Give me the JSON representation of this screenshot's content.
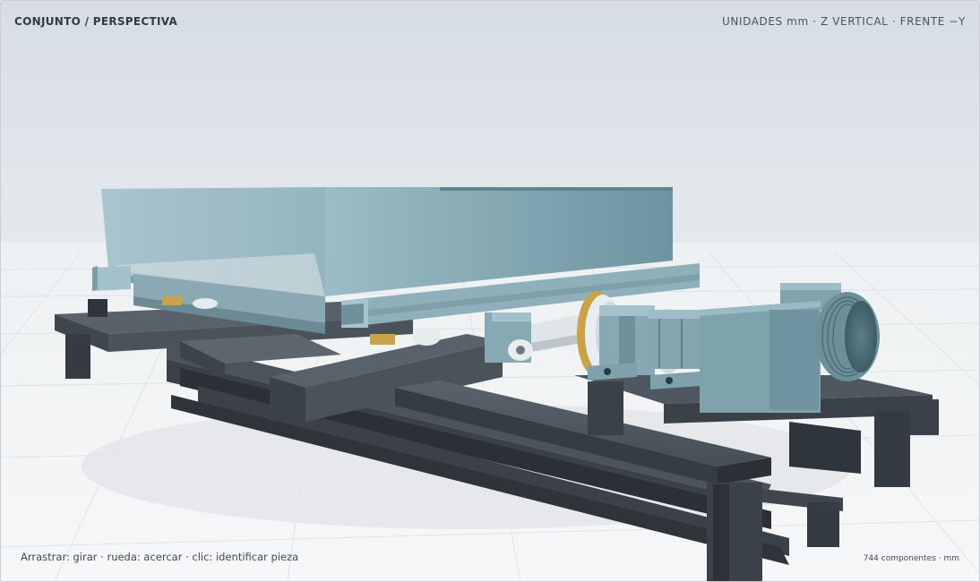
{
  "viewer": {
    "view_title": "CONJUNTO / PERSPECTIVA",
    "units_info": "UNIDADES mm · Z VERTICAL · FRENTE −Y",
    "controls_hint": "Arrastrar: girar · rueda: acercar · clic: identificar pieza",
    "component_count": "744 componentes · mm"
  },
  "colors": {
    "sky_top": "#d6dde4",
    "floor": "#eef0f1",
    "steel_dark": "#3a4149",
    "steel_mid": "#4f5861",
    "panel_blue": "#8fb2bd",
    "panel_blue_dark": "#6f96a2",
    "motor_blue": "#7fa4ae",
    "brass": "#c9a24a",
    "white_part": "#e6ebee"
  }
}
